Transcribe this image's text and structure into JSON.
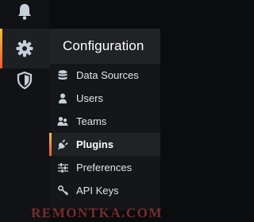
{
  "rail": {
    "items": [
      {
        "icon": "bell-icon",
        "active": false
      },
      {
        "icon": "gear-icon",
        "active": true
      },
      {
        "icon": "shield-icon",
        "active": false
      }
    ]
  },
  "menu": {
    "title": "Configuration",
    "items": [
      {
        "label": "Data Sources",
        "icon": "database-icon"
      },
      {
        "label": "Users",
        "icon": "user-icon"
      },
      {
        "label": "Teams",
        "icon": "users-icon"
      },
      {
        "label": "Plugins",
        "icon": "plug-icon",
        "active": true
      },
      {
        "label": "Preferences",
        "icon": "sliders-icon"
      },
      {
        "label": "API Keys",
        "icon": "key-icon"
      }
    ]
  },
  "watermark": "REMONTKA.COM",
  "colors": {
    "accent_top": "#ffbd3c",
    "accent_bottom": "#f05a28",
    "icon": "#c7d0d9"
  }
}
